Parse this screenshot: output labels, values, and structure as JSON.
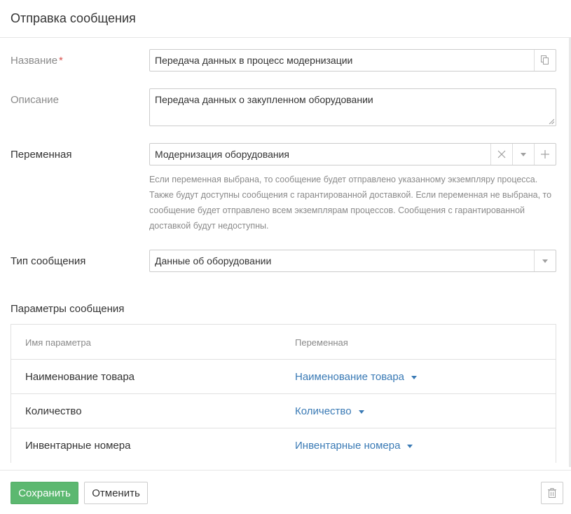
{
  "dialog": {
    "title": "Отправка сообщения"
  },
  "form": {
    "name": {
      "label": "Название",
      "required_mark": "*",
      "value": "Передача данных в процесс модернизации",
      "copy_icon": "copy-icon"
    },
    "description": {
      "label": "Описание",
      "value": "Передача данных о закупленном оборудовании"
    },
    "variable": {
      "label": "Переменная",
      "value": "Модернизация оборудования",
      "icons": [
        "clear-icon",
        "chevron-down-icon",
        "plus-icon"
      ],
      "hint": "Если переменная выбрана, то сообщение будет отправлено указанному экземпляру процесса. Также будут доступны сообщения с гарантированной доставкой. Если переменная не выбрана, то сообщение будет отправлено всем экземплярам процессов. Сообщения с гарантированной доставкой будут недоступны."
    },
    "message_type": {
      "label": "Тип сообщения",
      "value": "Данные об оборудовании"
    }
  },
  "params": {
    "title": "Параметры сообщения",
    "columns": [
      "Имя параметра",
      "Переменная"
    ],
    "rows": [
      {
        "name": "Наименование товара",
        "variable": "Наименование товара"
      },
      {
        "name": "Количество",
        "variable": "Количество"
      },
      {
        "name": "Инвентарные номера",
        "variable": "Инвентарные номера"
      }
    ]
  },
  "footer": {
    "save_label": "Сохранить",
    "cancel_label": "Отменить",
    "delete_icon": "trash-icon"
  },
  "colors": {
    "accent_green": "#5cb870",
    "link_blue": "#3a7ab5",
    "required_red": "#d9534f"
  }
}
